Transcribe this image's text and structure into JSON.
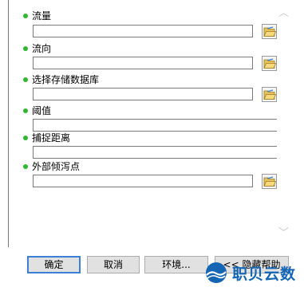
{
  "params": [
    {
      "label": "流量",
      "value": "",
      "has_browse": true
    },
    {
      "label": "流向",
      "value": "",
      "has_browse": true
    },
    {
      "label": "选择存储数据库",
      "value": "",
      "has_browse": true
    },
    {
      "label": "阈值",
      "value": "",
      "has_browse": false
    },
    {
      "label": "捕捉距离",
      "value": "",
      "has_browse": false
    },
    {
      "label": "外部倾泻点",
      "value": "",
      "has_browse": true
    }
  ],
  "buttons": {
    "ok": "确定",
    "cancel": "取消",
    "environments": "环境...",
    "hide_help": "<< 隐藏帮助"
  },
  "scroll": {
    "up": "︿",
    "down": "﹀"
  },
  "watermark": {
    "text": "职贝云数"
  },
  "colors": {
    "bullet": "#2fb82f",
    "default_button_border": "#3c7fd6",
    "watermark": "#1466b4"
  }
}
